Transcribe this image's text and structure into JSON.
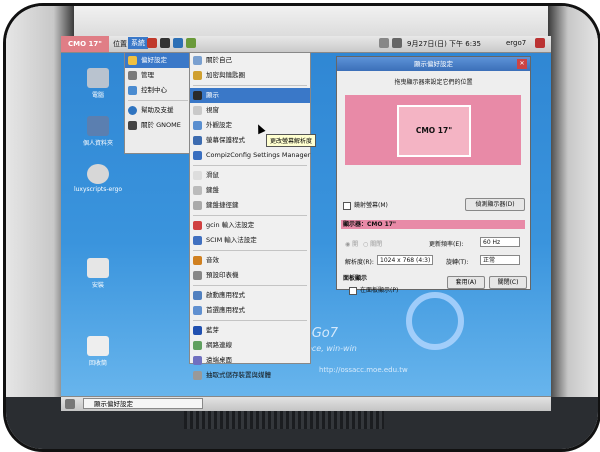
{
  "topbar": {
    "monitor_tab": "CMO 17\"",
    "menus": [
      "位置",
      "系統"
    ],
    "datetime": "9月27日(日) 下午 6:35",
    "username": "ergo7"
  },
  "desktop_icons": [
    "電腦",
    "個人資料夾",
    "luxyscripts-ergo",
    "安裝",
    "回收筒"
  ],
  "system_menu": [
    {
      "label": "偏好設定",
      "icon": "preferences-icon"
    },
    {
      "label": "管理",
      "icon": "admin-icon"
    },
    {
      "label": "控制中心",
      "icon": "control-center-icon"
    },
    {
      "label": "幫助及支援",
      "icon": "help-icon"
    },
    {
      "label": "關於 GNOME",
      "icon": "gnome-icon"
    }
  ],
  "prefs_menu": [
    {
      "label": "關於自己",
      "icon": "about-me-icon"
    },
    {
      "label": "加密與鑰匙圈",
      "icon": "keyring-icon"
    },
    {
      "label": "顯示",
      "icon": "display-icon",
      "selected": true
    },
    {
      "label": "視窗",
      "icon": "windows-icon"
    },
    {
      "label": "外觀設定",
      "icon": "appearance-icon"
    },
    {
      "label": "螢幕保護程式",
      "icon": "screensaver-icon"
    },
    {
      "label": "CompizConfig Settings Manager",
      "icon": "compiz-icon"
    },
    {
      "label": "滑鼠",
      "icon": "mouse-icon"
    },
    {
      "label": "鍵盤",
      "icon": "keyboard-icon"
    },
    {
      "label": "鍵盤捷徑鍵",
      "icon": "shortcuts-icon"
    },
    {
      "label": "gcin 輸入法設定",
      "icon": "gcin-icon"
    },
    {
      "label": "SCIM 輸入法設定",
      "icon": "scim-icon"
    },
    {
      "label": "音效",
      "icon": "sound-icon"
    },
    {
      "label": "預設印表機",
      "icon": "printer-icon"
    },
    {
      "label": "啟動應用程式",
      "icon": "startup-icon"
    },
    {
      "label": "首選應用程式",
      "icon": "preferred-apps-icon"
    },
    {
      "label": "藍芽",
      "icon": "bluetooth-icon"
    },
    {
      "label": "網路連線",
      "icon": "network-icon"
    },
    {
      "label": "遠端桌面",
      "icon": "remote-desktop-icon"
    },
    {
      "label": "抽取式儲存裝置與媒體",
      "icon": "removable-media-icon"
    }
  ],
  "tooltip": "更改螢幕解析度",
  "dialog": {
    "title": "顯示偏好設定",
    "subtitle": "拖曳顯示器來設定它們的位置",
    "monitor_name": "CMO 17\"",
    "mirror_label": "鏡射螢幕(M)",
    "detect_button": "偵測顯示器(D)",
    "monitor_label": "顯示器：CMO 17\"",
    "on_label": "開",
    "off_label": "關閉",
    "refresh_label": "更新頻率(E):",
    "refresh_value": "60 Hz",
    "resolution_label": "解析度(R):",
    "resolution_value": "1024 x 768 (4:3)",
    "rotation_label": "旋轉(T):",
    "rotation_value": "正常",
    "panel_section": "面板顯示",
    "panel_checkbox": "在面板顯示(P)",
    "apply_button": "套用(A)",
    "close_button": "關閉(C)"
  },
  "wallpaper": {
    "brand": "-Go7",
    "tagline": "ace, win-win",
    "url": "http://ossacc.moe.edu.tw"
  },
  "taskbar": {
    "task_label": "顯示偏好設定"
  }
}
